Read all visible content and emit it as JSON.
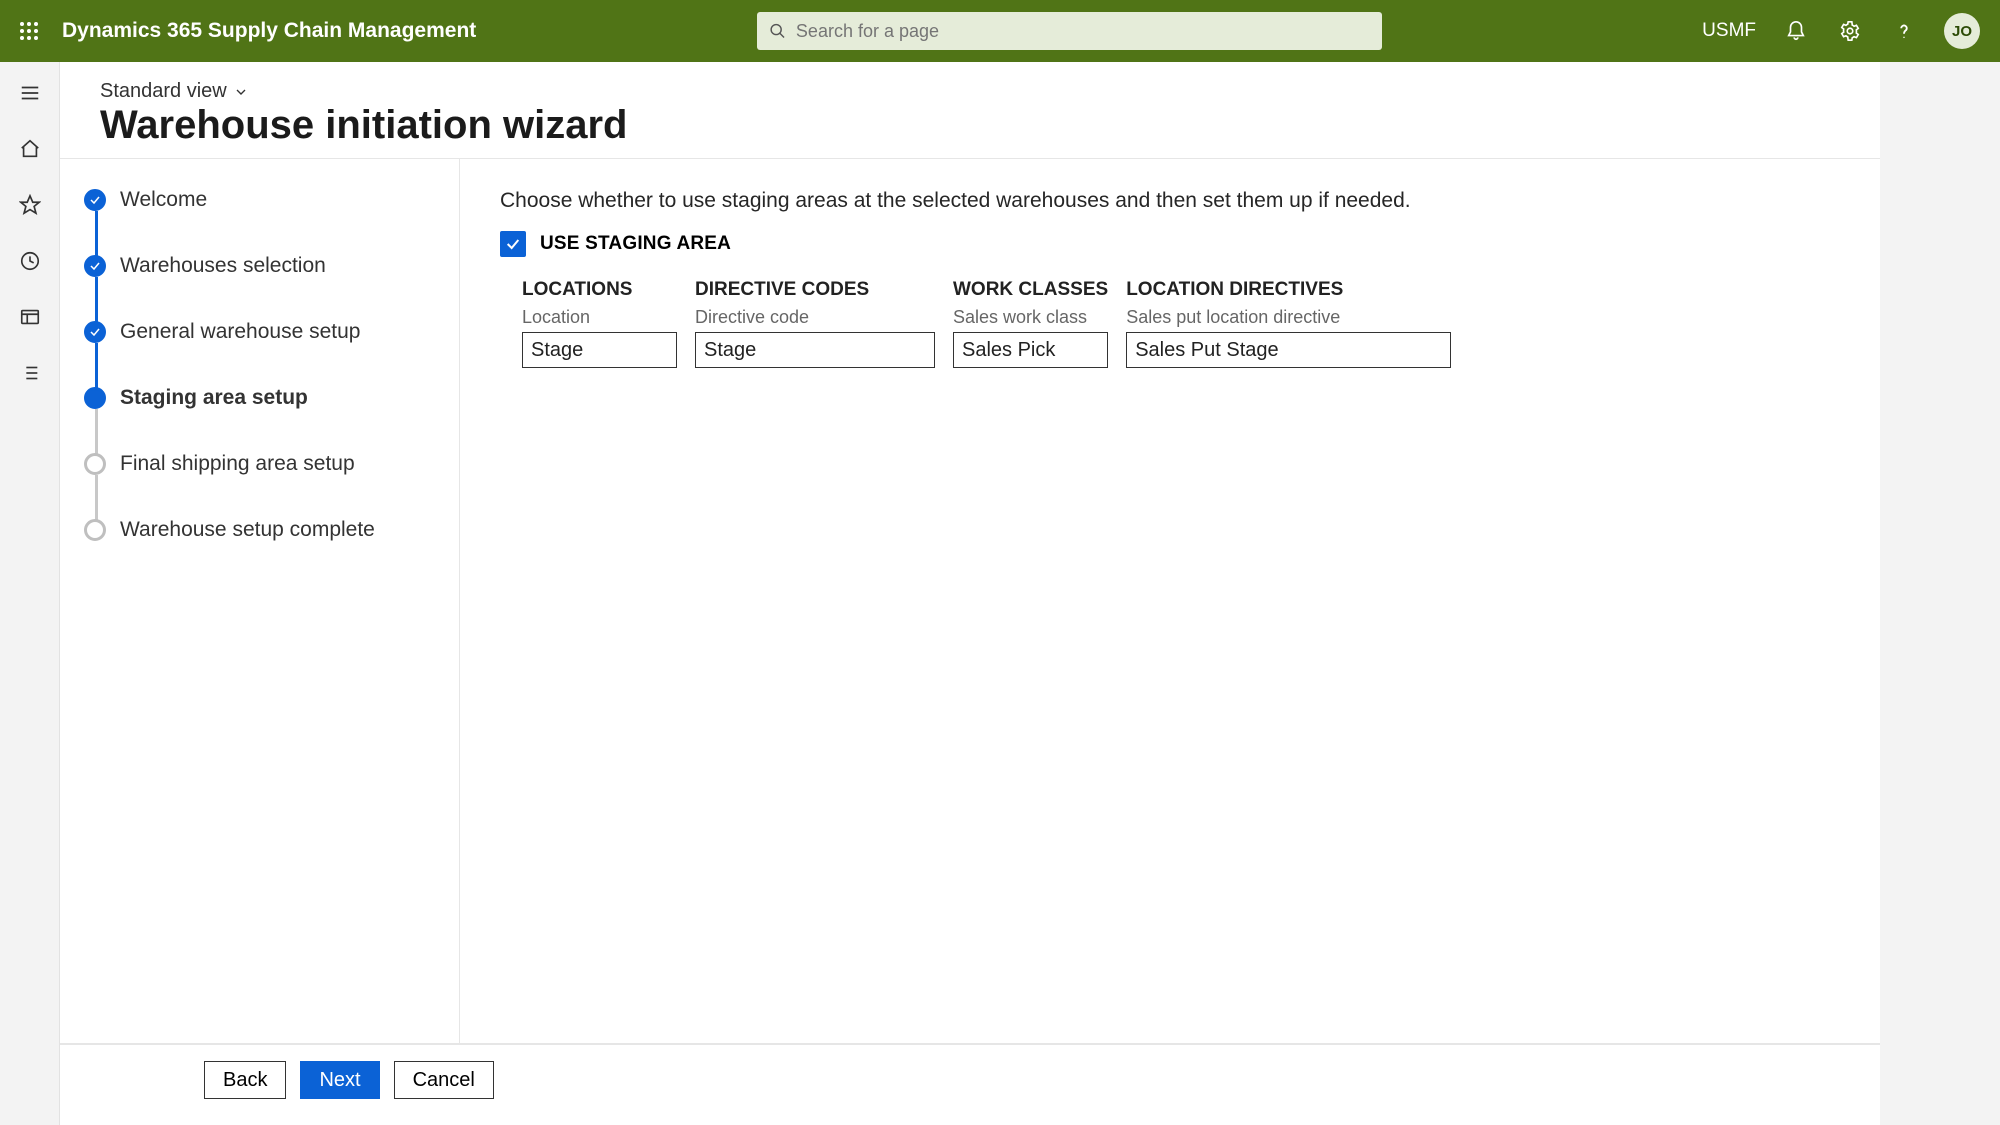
{
  "topbar": {
    "appname": "Dynamics 365 Supply Chain Management",
    "search_placeholder": "Search for a page",
    "company": "USMF",
    "avatar_initials": "JO"
  },
  "page": {
    "view_label": "Standard view",
    "title": "Warehouse initiation wizard"
  },
  "steps": [
    {
      "label": "Welcome",
      "state": "done"
    },
    {
      "label": "Warehouses selection",
      "state": "done"
    },
    {
      "label": "General warehouse setup",
      "state": "done"
    },
    {
      "label": "Staging area setup",
      "state": "current"
    },
    {
      "label": "Final shipping area setup",
      "state": "todo"
    },
    {
      "label": "Warehouse setup complete",
      "state": "todo"
    }
  ],
  "pane": {
    "instruction": "Choose whether to use staging areas at the selected warehouses and then set them up if needed.",
    "use_staging_label": "USE STAGING AREA",
    "use_staging_checked": true,
    "columns": [
      {
        "header": "LOCATIONS",
        "field_label": "Location",
        "value": "Stage",
        "width": "w1"
      },
      {
        "header": "DIRECTIVE CODES",
        "field_label": "Directive code",
        "value": "Stage",
        "width": "w2"
      },
      {
        "header": "WORK CLASSES",
        "field_label": "Sales work class",
        "value": "Sales Pick",
        "width": "w3"
      },
      {
        "header": "LOCATION DIRECTIVES",
        "field_label": "Sales put location directive",
        "value": "Sales Put Stage",
        "width": "w4"
      }
    ]
  },
  "footer": {
    "back": "Back",
    "next": "Next",
    "cancel": "Cancel"
  }
}
